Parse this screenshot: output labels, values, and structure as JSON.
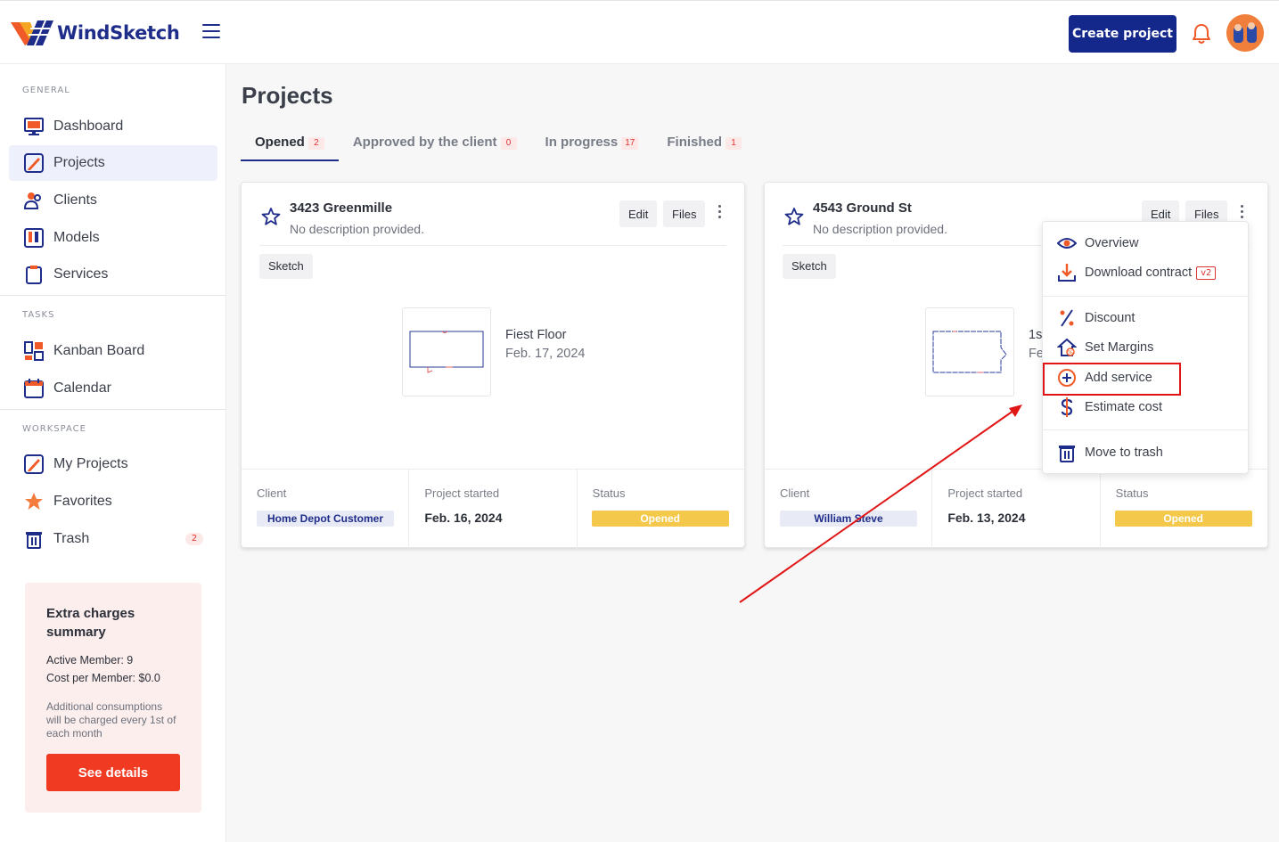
{
  "app": {
    "name": "WindSketch"
  },
  "header": {
    "create_label": "Create project"
  },
  "sidebar": {
    "sections": [
      "GENERAL",
      "TASKS",
      "WORKSPACE"
    ],
    "items": [
      {
        "label": "Dashboard",
        "icon": "dashboard-icon"
      },
      {
        "label": "Projects",
        "icon": "projects-icon",
        "active": true
      },
      {
        "label": "Clients",
        "icon": "clients-icon"
      },
      {
        "label": "Models",
        "icon": "models-icon"
      },
      {
        "label": "Services",
        "icon": "services-icon"
      },
      {
        "label": "Kanban Board",
        "icon": "kanban-icon"
      },
      {
        "label": "Calendar",
        "icon": "calendar-icon"
      },
      {
        "label": "My Projects",
        "icon": "my-projects-icon"
      },
      {
        "label": "Favorites",
        "icon": "star-icon"
      },
      {
        "label": "Trash",
        "icon": "trash-icon",
        "badge": "2"
      }
    ],
    "charges": {
      "title": "Extra charges summary",
      "active_member": "Active Member: 9",
      "cost_per_member": "Cost per Member: $0.0",
      "note": "Additional consumptions will be charged every 1st of each month",
      "button": "See details"
    }
  },
  "main": {
    "title": "Projects",
    "tabs": [
      {
        "label": "Opened",
        "count": "2",
        "active": true
      },
      {
        "label": "Approved by the client",
        "count": "0"
      },
      {
        "label": "In progress",
        "count": "17"
      },
      {
        "label": "Finished",
        "count": "1"
      }
    ],
    "cards": [
      {
        "title": "3423 Greenmille",
        "description": "No description provided.",
        "edit": "Edit",
        "files": "Files",
        "chip": "Sketch",
        "floor_name": "Fiest Floor",
        "floor_date": "Feb. 17, 2024",
        "client_label": "Client",
        "client": "Home Depot Customer",
        "started_label": "Project started",
        "started": "Feb. 16, 2024",
        "status_label": "Status",
        "status": "Opened"
      },
      {
        "title": "4543 Ground St",
        "description": "No description provided.",
        "edit": "Edit",
        "files": "Files",
        "chip": "Sketch",
        "floor_name": "1st",
        "floor_date": "Fe",
        "client_label": "Client",
        "client": "William Steve",
        "started_label": "Project started",
        "started": "Feb. 13, 2024",
        "status_label": "Status",
        "status": "Opened"
      }
    ]
  },
  "menu": {
    "items": [
      {
        "label": "Overview",
        "icon": "eye-icon"
      },
      {
        "label": "Download contract",
        "icon": "download-icon",
        "badge": "v2"
      },
      {
        "label": "Discount",
        "icon": "percent-icon"
      },
      {
        "label": "Set Margins",
        "icon": "margins-icon"
      },
      {
        "label": "Add service",
        "icon": "plus-circle-icon"
      },
      {
        "label": "Estimate cost",
        "icon": "dollar-icon"
      },
      {
        "label": "Move to trash",
        "icon": "trash-icon"
      }
    ]
  },
  "colors": {
    "brand": "#14288c",
    "accent": "#f03a22",
    "status": "#f4c84a",
    "highlight": "#e01515"
  }
}
